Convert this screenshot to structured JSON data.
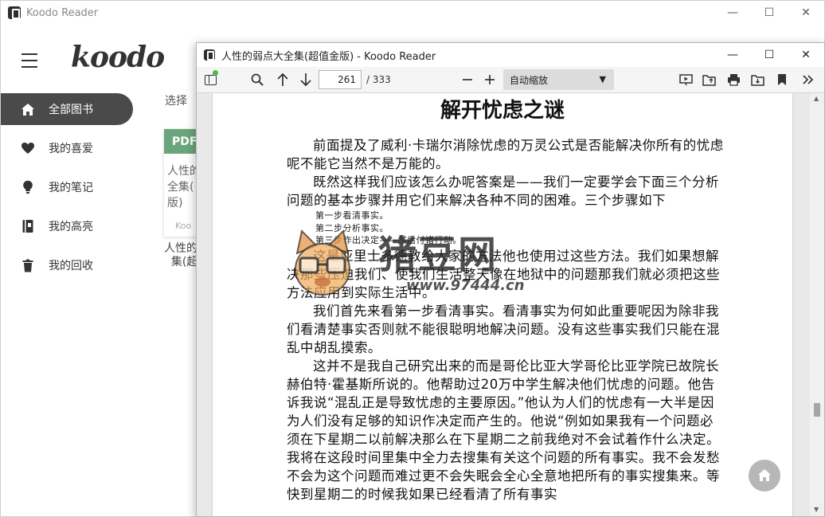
{
  "main": {
    "title": "Koodo Reader",
    "logo": "koodo",
    "nav": [
      {
        "label": "全部图书",
        "icon": "home-icon"
      },
      {
        "label": "我的喜爱",
        "icon": "heart-icon"
      },
      {
        "label": "我的笔记",
        "icon": "bulb-icon"
      },
      {
        "label": "我的高亮",
        "icon": "highlight-book-icon"
      },
      {
        "label": "我的回收",
        "icon": "trash-icon"
      }
    ],
    "select_label": "选择",
    "book": {
      "badge": "PDF",
      "card_title": "人性的\n全集(\n版)",
      "card_author": "Koo",
      "name": "人性的\n  集(超"
    }
  },
  "reader": {
    "title": "人性的弱点大全集(超值金版) - Koodo Reader",
    "current_page": "261",
    "total_pages": "/ 333",
    "zoom": "自动缩放",
    "chapter_title": "解开忧虑之谜",
    "paragraphs": [
      "前面提及了威利·卡瑞尔消除忧虑的万灵公式是否能解决你所有的忧虑呢不能它当然不是万能的。",
      "既然这样我们应该怎么办呢答案是——我们一定要学会下面三个分析问题的基本步骤并用它们来解决各种不同的困难。三个步骤如下"
    ],
    "steps": [
      "第一步看清事实。",
      "第二步分析事实。",
      "第三步作出决定——然后付诸行动。"
    ],
    "paragraphs2": [
      "这是亚里士多德教给大家的方法他也使用过这些方法。我们如果想解决那些压迫我们、使我们生活整天像在地狱中的问题那我们就必须把这些方法应用到实际生活中。",
      "我们首先来看第一步看清事实。看清事实为何如此重要呢因为除非我们看清楚事实否则就不能很聪明地解决问题。没有这些事实我们只能在混乱中胡乱摸索。",
      "这并不是我自己研究出来的而是哥伦比亚大学哥伦比亚学院已故院长赫伯特·霍基斯所说的。他帮助过20万中学生解决他们忧虑的问题。他告诉我说“混乱正是导致忧虑的主要原因。”他认为人们的忧虑有一大半是因为人们没有足够的知识作决定而产生的。他说“例如如果我有一个问题必须在下星期二以前解决那么在下星期二之前我绝对不会试着作什么决定。我将在这段时间里集中全力去搜集有关这个问题的所有事实。我不会发愁不会为这个问题而难过更不会失眠会全心全意地把所有的事实搜集来。等快到星期二的时候我如果已经看清了所有事实"
    ]
  },
  "watermark": {
    "text": "猪豆网",
    "url": "www.97444.cn"
  }
}
